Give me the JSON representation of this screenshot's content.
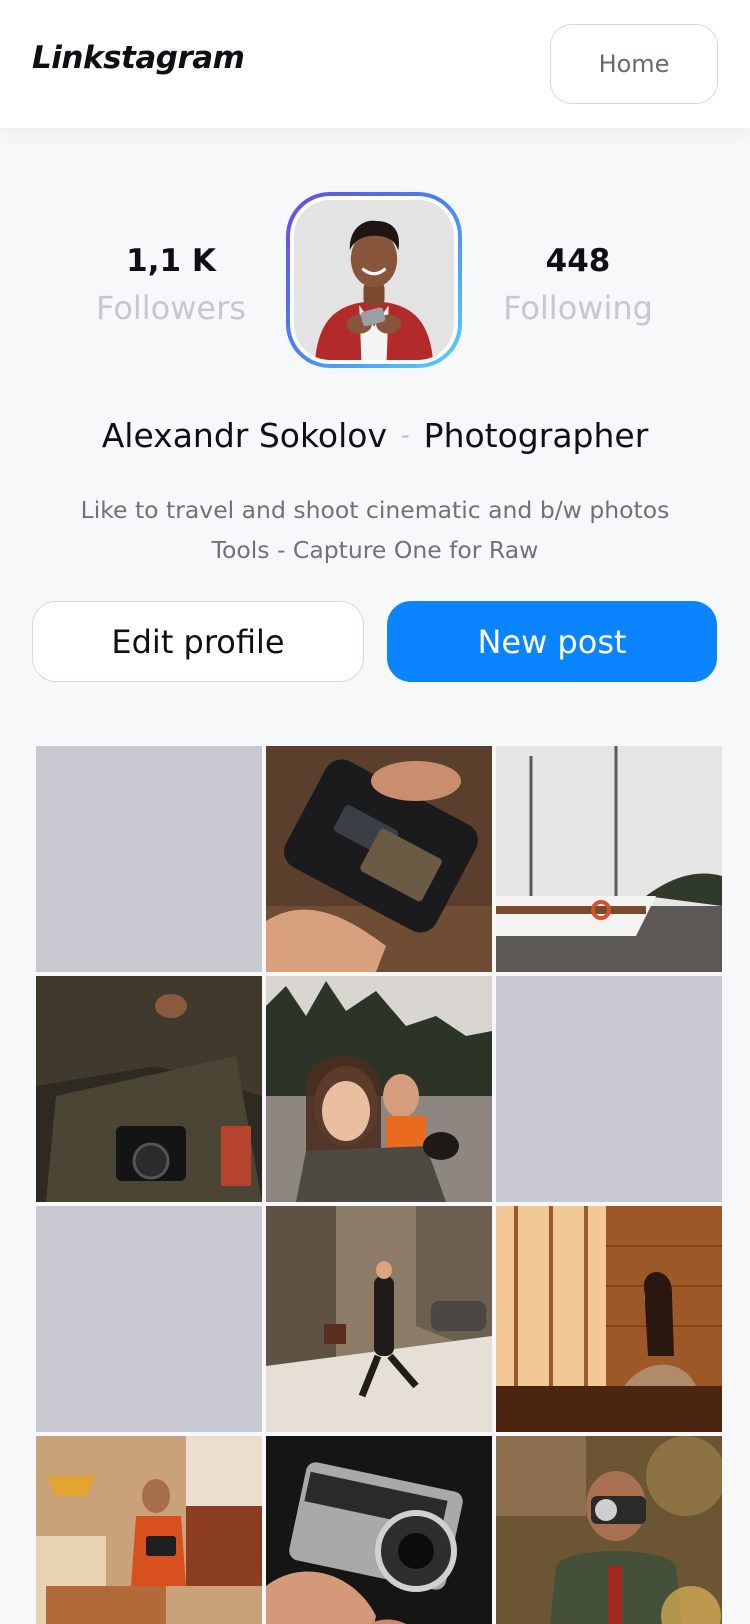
{
  "app": {
    "title": "Linkstagram"
  },
  "header": {
    "home_label": "Home"
  },
  "profile": {
    "followers_count": "1,1 K",
    "followers_label": "Followers",
    "following_count": "448",
    "following_label": "Following",
    "name": "Alexandr Sokolov",
    "separator": "-",
    "occupation": "Photographer",
    "bio_line1": "Like to travel and shoot cinematic and b/w photos",
    "bio_line2": "Tools - Capture One for Raw"
  },
  "actions": {
    "edit_label": "Edit profile",
    "new_post_label": "New post"
  },
  "posts": [
    {
      "kind": "placeholder"
    },
    {
      "kind": "photo",
      "subject": "hands-holding-camera"
    },
    {
      "kind": "photo",
      "subject": "sailboats-on-river"
    },
    {
      "kind": "photo",
      "subject": "man-with-vintage-camera"
    },
    {
      "kind": "photo",
      "subject": "couple-selfie-by-lake"
    },
    {
      "kind": "placeholder"
    },
    {
      "kind": "placeholder"
    },
    {
      "kind": "photo",
      "subject": "person-on-snowy-street"
    },
    {
      "kind": "photo",
      "subject": "woman-by-window"
    },
    {
      "kind": "photo",
      "subject": "man-in-living-room-with-camera"
    },
    {
      "kind": "photo",
      "subject": "hands-holding-silver-camera"
    },
    {
      "kind": "photo",
      "subject": "man-taking-photo-outdoors"
    }
  ],
  "colors": {
    "accent": "#0a84ff",
    "placeholder": "#c8c9d0",
    "muted_label": "#c5c8cf",
    "avatar_ring_start": "#6a4be6",
    "avatar_ring_end": "#5ad2ef"
  }
}
